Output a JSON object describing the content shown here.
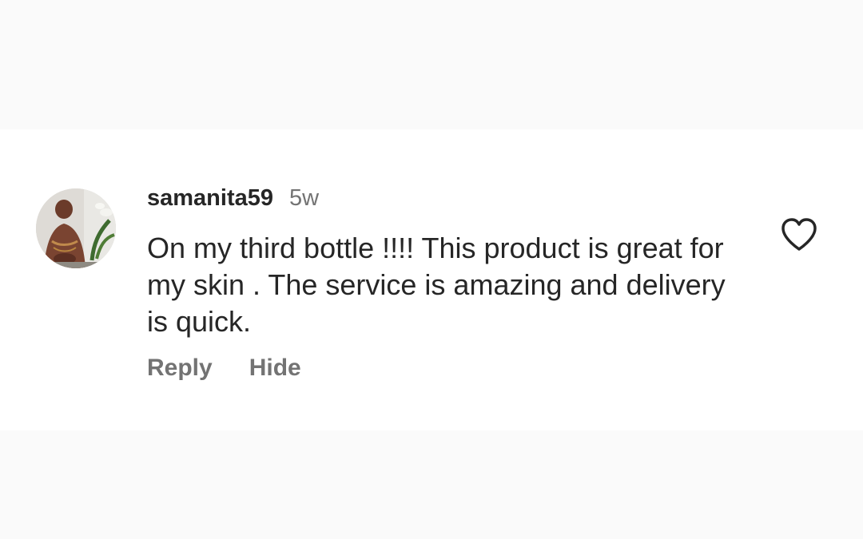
{
  "comment": {
    "username": "samanita59",
    "timestamp": "5w",
    "text": "On my third bottle !!!! This product is great for my skin . The service is amazing and delivery is quick.",
    "avatar_icon": "profile-photo",
    "like_icon": "heart-outline-icon"
  },
  "actions": {
    "reply_label": "Reply",
    "hide_label": "Hide"
  },
  "colors": {
    "text_primary": "#262626",
    "text_secondary": "#737373",
    "card_background": "#ffffff",
    "page_background": "#fafafa"
  }
}
